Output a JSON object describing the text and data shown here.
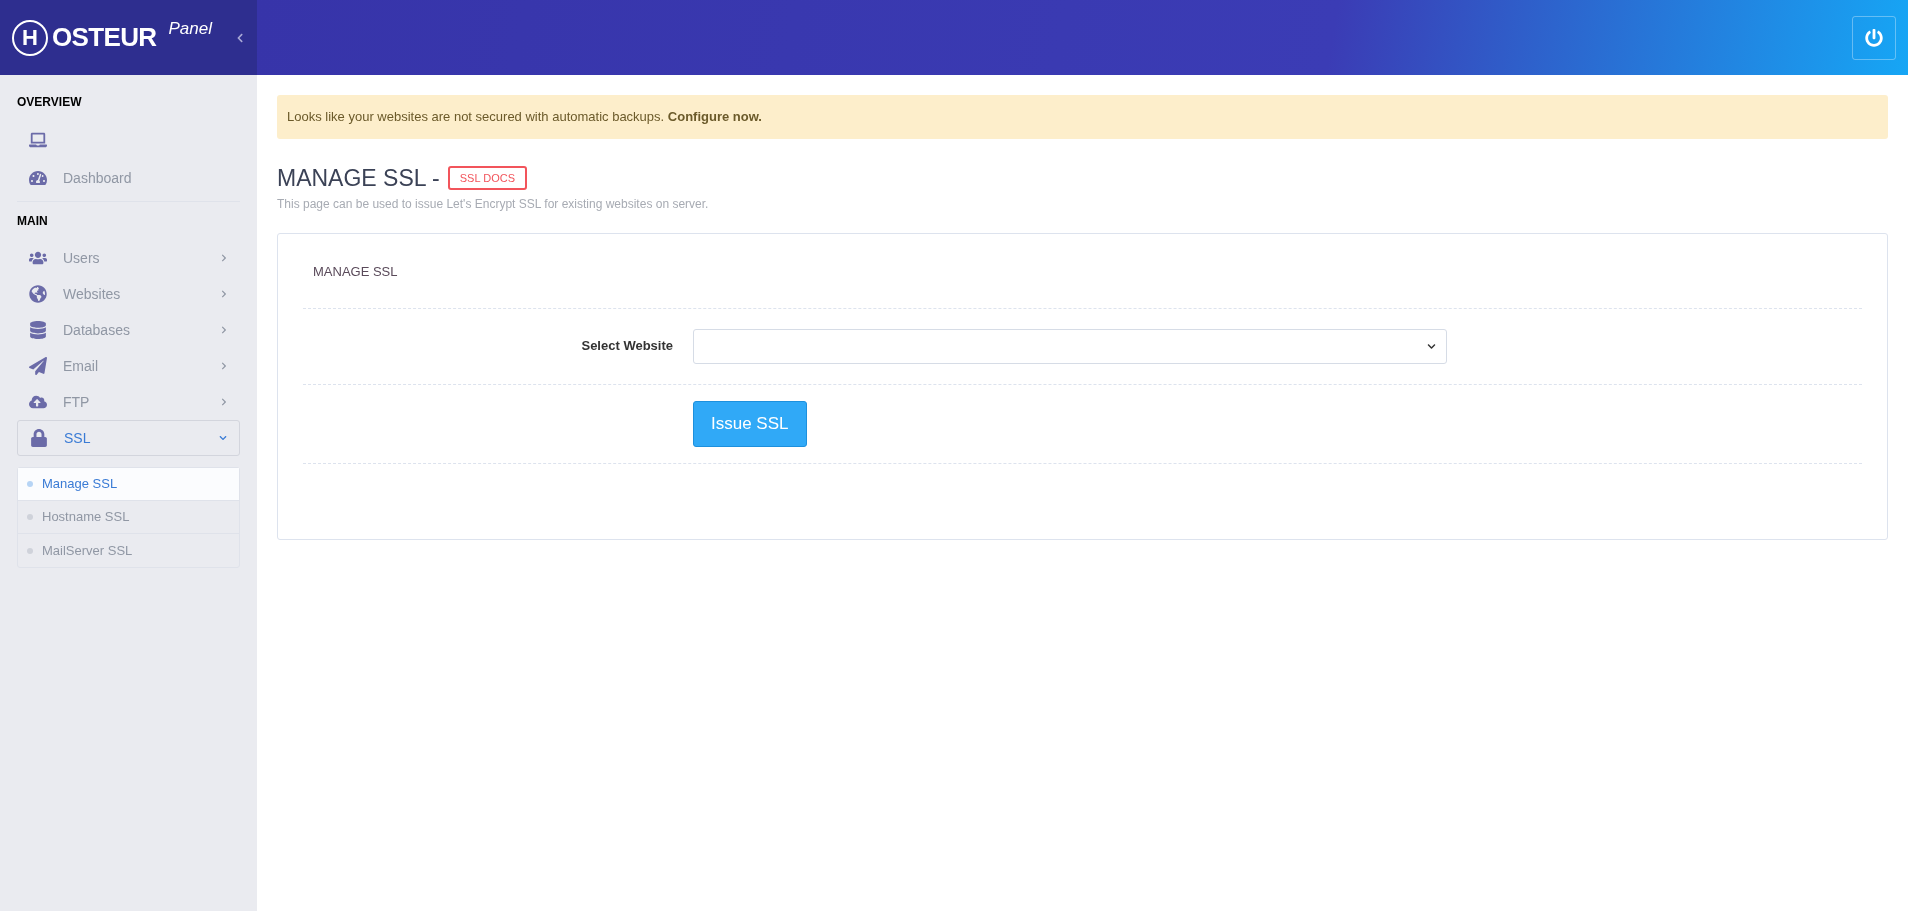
{
  "logo": {
    "letter": "H",
    "rest": "OSTEUR",
    "suffix": "Panel"
  },
  "sidebar": {
    "sections": [
      {
        "title": "OVERVIEW",
        "items": [
          {
            "kind": "link"
          },
          {
            "kind": "link",
            "label": "Dashboard"
          }
        ]
      },
      {
        "title": "MAIN",
        "items": [
          {
            "kind": "group",
            "label": "Users",
            "expanded": false
          },
          {
            "kind": "group",
            "label": "Websites",
            "expanded": false
          },
          {
            "kind": "group",
            "label": "Databases",
            "expanded": false
          },
          {
            "kind": "group",
            "label": "Email",
            "expanded": false
          },
          {
            "kind": "group",
            "label": "FTP",
            "expanded": false
          },
          {
            "kind": "group",
            "label": "SSL",
            "expanded": true,
            "children": [
              {
                "label": "Manage SSL",
                "selected": true
              },
              {
                "label": "Hostname SSL",
                "selected": false
              },
              {
                "label": "MailServer SSL",
                "selected": false
              }
            ]
          }
        ]
      }
    ]
  },
  "alert": {
    "text": "Looks like your websites are not secured with automatic backups. **Configure now.**"
  },
  "page": {
    "title": "MANAGE SSL -",
    "docs_button": "SSL DOCS",
    "subtitle": "This page can be used to issue Let's Encrypt SSL for existing websites on server."
  },
  "card": {
    "title": "MANAGE SSL",
    "field_label": "Select Website",
    "submit": "Issue SSL"
  }
}
